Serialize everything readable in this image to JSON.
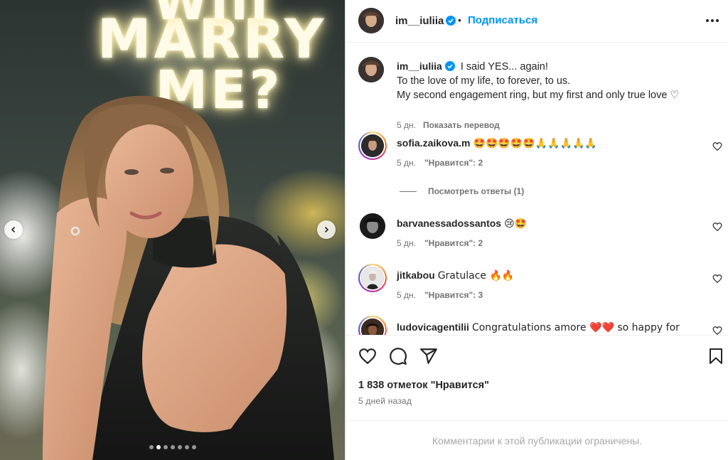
{
  "media": {
    "neon_sign": {
      "line_top": "Will",
      "line1": "MARRY",
      "line2": "ME?"
    },
    "carousel": {
      "total_slides": 7,
      "active_slide": 2
    }
  },
  "header": {
    "username": "im__iuliia",
    "separator": "•",
    "follow_label": "Подписаться",
    "icons": {
      "verified": "verified-badge-icon",
      "more": "more-horizontal-icon"
    }
  },
  "caption": {
    "username": "im__iuliia",
    "text_line1": "I said YES... again!",
    "text_line2": "To the love of my life, to forever, to us.",
    "text_line3": "My second engagement ring, but my first and only true love ♡",
    "age": "5 дн.",
    "translate_label": "Показать перевод"
  },
  "comments": [
    {
      "username": "sofia.zaikova.m",
      "text": "🤩🤩🤩🤩🤩🙏🙏🙏🙏🙏",
      "age": "5 дн.",
      "likes": "\"Нравится\": 2",
      "story_ring": true
    },
    {
      "username": "barvanessadossantos",
      "text": "😢🤩",
      "age": "5 дн.",
      "likes": "\"Нравится\": 2",
      "story_ring": false
    },
    {
      "username": "jitkabou",
      "text": "Gratulace 🔥🔥",
      "age": "5 дн.",
      "likes": "\"Нравится\": 3",
      "story_ring": true
    },
    {
      "username": "ludovicagentilii",
      "text": "Congratulations amore ❤️❤️ so happy for",
      "age": "",
      "likes": "",
      "story_ring": true
    }
  ],
  "view_replies_label": "Посмотреть ответы (1)",
  "actions": {
    "icons": [
      "heart-icon",
      "comment-icon",
      "share-icon",
      "bookmark-icon"
    ],
    "likes_count": "1 838 отметок \"Нравится\"",
    "date": "5 дней назад"
  },
  "footer": {
    "comments_limited": "Комментарии к этой публикации ограничены."
  },
  "colors": {
    "accent": "#0095f6",
    "text": "#262626",
    "secondary": "#737373",
    "verified": "#0095f6"
  }
}
